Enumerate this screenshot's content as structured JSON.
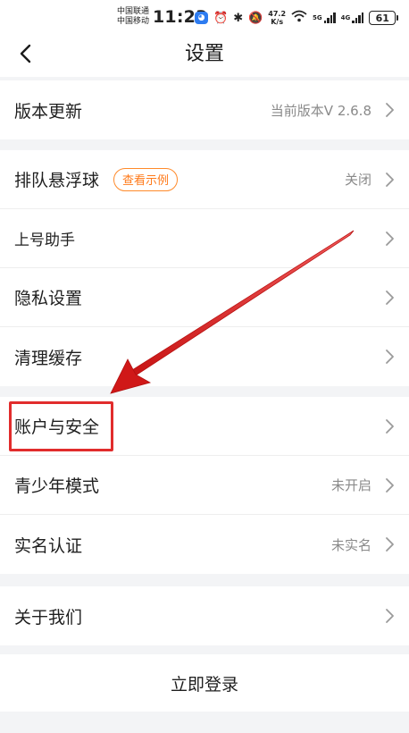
{
  "status_bar": {
    "carrier_1": "中国联通",
    "carrier_2": "中国移动",
    "time": "11:23",
    "net_speed_value": "47.2",
    "net_speed_unit": "K/s",
    "net_label_1": "5G",
    "net_label_2": "4G",
    "battery": "61"
  },
  "nav": {
    "title": "设置"
  },
  "sections": {
    "update": {
      "label": "版本更新",
      "value": "当前版本V 2.6.8"
    },
    "queue_ball": {
      "label": "排队悬浮球",
      "demo_button": "查看示例",
      "value": "关闭"
    },
    "account_helper": {
      "label": "上号助手"
    },
    "privacy": {
      "label": "隐私设置"
    },
    "clear_cache": {
      "label": "清理缓存"
    },
    "account_security": {
      "label": "账户与安全"
    },
    "teen_mode": {
      "label": "青少年模式",
      "value": "未开启"
    },
    "real_name": {
      "label": "实名认证",
      "value": "未实名"
    },
    "about": {
      "label": "关于我们"
    }
  },
  "login": {
    "label": "立即登录"
  },
  "annotation": {
    "highlight_color": "#e12c2c",
    "arrow_color": "#e01f1f"
  }
}
